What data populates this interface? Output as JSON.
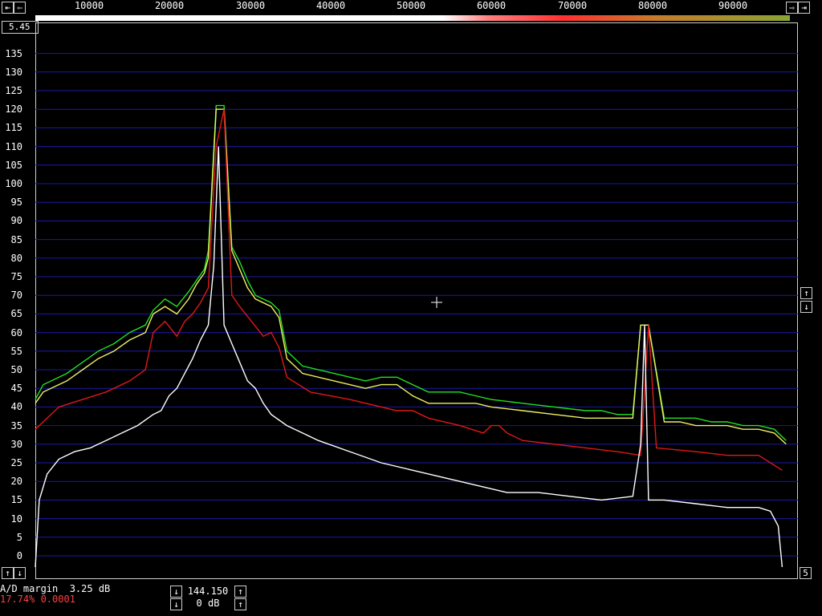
{
  "top_scale": {
    "labels": [
      "10000",
      "20000",
      "30000",
      "40000",
      "50000",
      "60000",
      "70000",
      "80000",
      "90000"
    ],
    "left_arrows": [
      "⇤",
      "⇦"
    ],
    "right_arrows": [
      "⇨",
      "⇥"
    ]
  },
  "corner_readout": "5.45",
  "side_buttons": {
    "right_up": "↑",
    "right_down": "↓",
    "bottom_left_up": "↑",
    "bottom_left_down": "↓",
    "bottom_right": "5"
  },
  "status": {
    "ad_margin": "A/D margin  3.25 dB",
    "stats": "17.74% 0.0001"
  },
  "stepper": {
    "freq_value": "144.150",
    "db_value": "0 dB",
    "up_label": "↑",
    "down_label": "↓"
  },
  "colors": {
    "grid": "#1a1aa8",
    "green": "#22e022",
    "yellow": "#f0f060",
    "red": "#e01818",
    "white": "#ffffff",
    "stats_text": "#ff4040"
  },
  "chart_data": {
    "type": "line",
    "title": "",
    "xlabel": "",
    "ylabel": "",
    "xlim": [
      0,
      97000
    ],
    "ylim": [
      -5,
      138
    ],
    "y_ticks": [
      0,
      5,
      10,
      15,
      20,
      25,
      30,
      35,
      40,
      45,
      50,
      55,
      60,
      65,
      70,
      75,
      80,
      85,
      90,
      95,
      100,
      105,
      110,
      115,
      120,
      125,
      130,
      135
    ],
    "grid": true,
    "series": [
      {
        "color": "green",
        "x": [
          0,
          1000,
          4000,
          6000,
          8000,
          10000,
          12000,
          14000,
          15000,
          16500,
          18000,
          19500,
          20500,
          21500,
          22000,
          23000,
          24000,
          25000,
          26000,
          27000,
          28000,
          30000,
          31000,
          32000,
          34000,
          38000,
          42000,
          44000,
          46000,
          48000,
          50000,
          54000,
          56000,
          58000,
          62000,
          66000,
          70000,
          72000,
          74000,
          76000,
          77000,
          78000,
          80000,
          82000,
          84000,
          86000,
          88000,
          90000,
          92000,
          94000,
          95500
        ],
        "y": [
          42,
          46,
          49,
          52,
          55,
          57,
          60,
          62,
          66,
          69,
          67,
          71,
          74,
          77,
          82,
          121,
          121,
          83,
          79,
          74,
          70,
          68,
          66,
          55,
          51,
          49,
          47,
          48,
          48,
          46,
          44,
          44,
          43,
          42,
          41,
          40,
          39,
          39,
          38,
          38,
          62,
          62,
          37,
          37,
          37,
          36,
          36,
          35,
          35,
          34,
          31
        ]
      },
      {
        "color": "yellow",
        "x": [
          0,
          1000,
          4000,
          6000,
          8000,
          10000,
          12000,
          14000,
          15000,
          16500,
          18000,
          19500,
          20500,
          21500,
          22000,
          23000,
          24000,
          25000,
          26000,
          27000,
          28000,
          30000,
          31000,
          32000,
          34000,
          38000,
          42000,
          44000,
          46000,
          48000,
          50000,
          54000,
          56000,
          58000,
          62000,
          66000,
          70000,
          72000,
          74000,
          76000,
          77000,
          78000,
          80000,
          82000,
          84000,
          86000,
          88000,
          90000,
          92000,
          94000,
          95500
        ],
        "y": [
          41,
          44,
          47,
          50,
          53,
          55,
          58,
          60,
          65,
          67,
          65,
          69,
          73,
          76,
          80,
          120,
          120,
          82,
          77,
          72,
          69,
          67,
          64,
          53,
          49,
          47,
          45,
          46,
          46,
          43,
          41,
          41,
          41,
          40,
          39,
          38,
          37,
          37,
          37,
          37,
          62,
          62,
          36,
          36,
          35,
          35,
          35,
          34,
          34,
          33,
          30
        ]
      },
      {
        "color": "red",
        "x": [
          0,
          1000,
          3000,
          6000,
          9000,
          12000,
          14000,
          15000,
          16500,
          18000,
          19000,
          20000,
          21000,
          22000,
          23000,
          24000,
          25000,
          26000,
          27500,
          29000,
          30000,
          31000,
          32000,
          35000,
          40000,
          44000,
          46000,
          48000,
          50000,
          54000,
          57000,
          58000,
          59000,
          60000,
          62000,
          66000,
          70000,
          74000,
          77000,
          78000,
          79000,
          84000,
          88000,
          92000,
          95000
        ],
        "y": [
          34,
          36,
          40,
          42,
          44,
          47,
          50,
          60,
          63,
          59,
          63,
          65,
          68,
          72,
          110,
          120,
          70,
          67,
          63,
          59,
          60,
          56,
          48,
          44,
          42,
          40,
          39,
          39,
          37,
          35,
          33,
          35,
          35,
          33,
          31,
          30,
          29,
          28,
          27,
          62,
          29,
          28,
          27,
          27,
          23
        ]
      },
      {
        "color": "white",
        "x": [
          0,
          500,
          1500,
          3000,
          5000,
          7000,
          9000,
          11000,
          13000,
          15000,
          16000,
          17000,
          18000,
          19000,
          20000,
          21000,
          22000,
          22700,
          23300,
          24000,
          25000,
          26000,
          27000,
          28000,
          29000,
          30000,
          32000,
          36000,
          40000,
          44000,
          48000,
          52000,
          56000,
          60000,
          64000,
          68000,
          72000,
          76000,
          77000,
          77500,
          78000,
          80000,
          84000,
          88000,
          92000,
          93500,
          94500,
          95000
        ],
        "y": [
          -3,
          15,
          22,
          26,
          28,
          29,
          31,
          33,
          35,
          38,
          39,
          43,
          45,
          49,
          53,
          58,
          62,
          78,
          110,
          62,
          57,
          52,
          47,
          45,
          41,
          38,
          35,
          31,
          28,
          25,
          23,
          21,
          19,
          17,
          17,
          16,
          15,
          16,
          30,
          62,
          15,
          15,
          14,
          13,
          13,
          12,
          8,
          -3
        ]
      }
    ],
    "annotations": [
      "5.45"
    ]
  }
}
